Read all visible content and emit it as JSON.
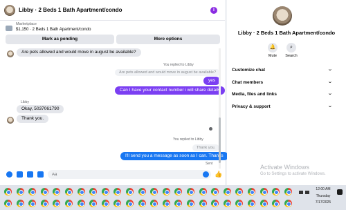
{
  "header": {
    "title": "Libby · 2 Beds 1 Bath Apartment/condo",
    "info_icon": "i"
  },
  "marketplace": {
    "label": "Marketplace",
    "detail": "$1,150 · 2 Beds 1 Bath Apartment/condo"
  },
  "actions": {
    "mark_pending": "Mark as pending",
    "more_options": "More options"
  },
  "messages": {
    "m1": "Are pets allowed and would move in august be available?",
    "replied1": "You replied to Libby",
    "quoted1": "Are pets allowed and would move in august be available?",
    "m2": "yes",
    "m3": "Can I have your contact number i will share details",
    "sender": "Libby",
    "m4": "Okay, 5037061790",
    "m5": "Thank you.",
    "replied2": "You replied to Libby",
    "quoted2": "Thank you.",
    "m6": "I'll send you a message as soon as I can. Thanks",
    "status": "Sent"
  },
  "composer": {
    "placeholder": "Aa"
  },
  "side": {
    "title": "Libby · 2 Beds 1 Bath Apartment/condo",
    "mute": "Mute",
    "search": "Search",
    "sections": [
      "Customize chat",
      "Chat members",
      "Media, files and links",
      "Privacy & support"
    ]
  },
  "watermark": {
    "line1": "Activate Windows",
    "line2": "Go to Settings to activate Windows."
  },
  "taskbar": {
    "time": "12:00 AM",
    "day": "Thursday",
    "date": "7/17/2025"
  }
}
